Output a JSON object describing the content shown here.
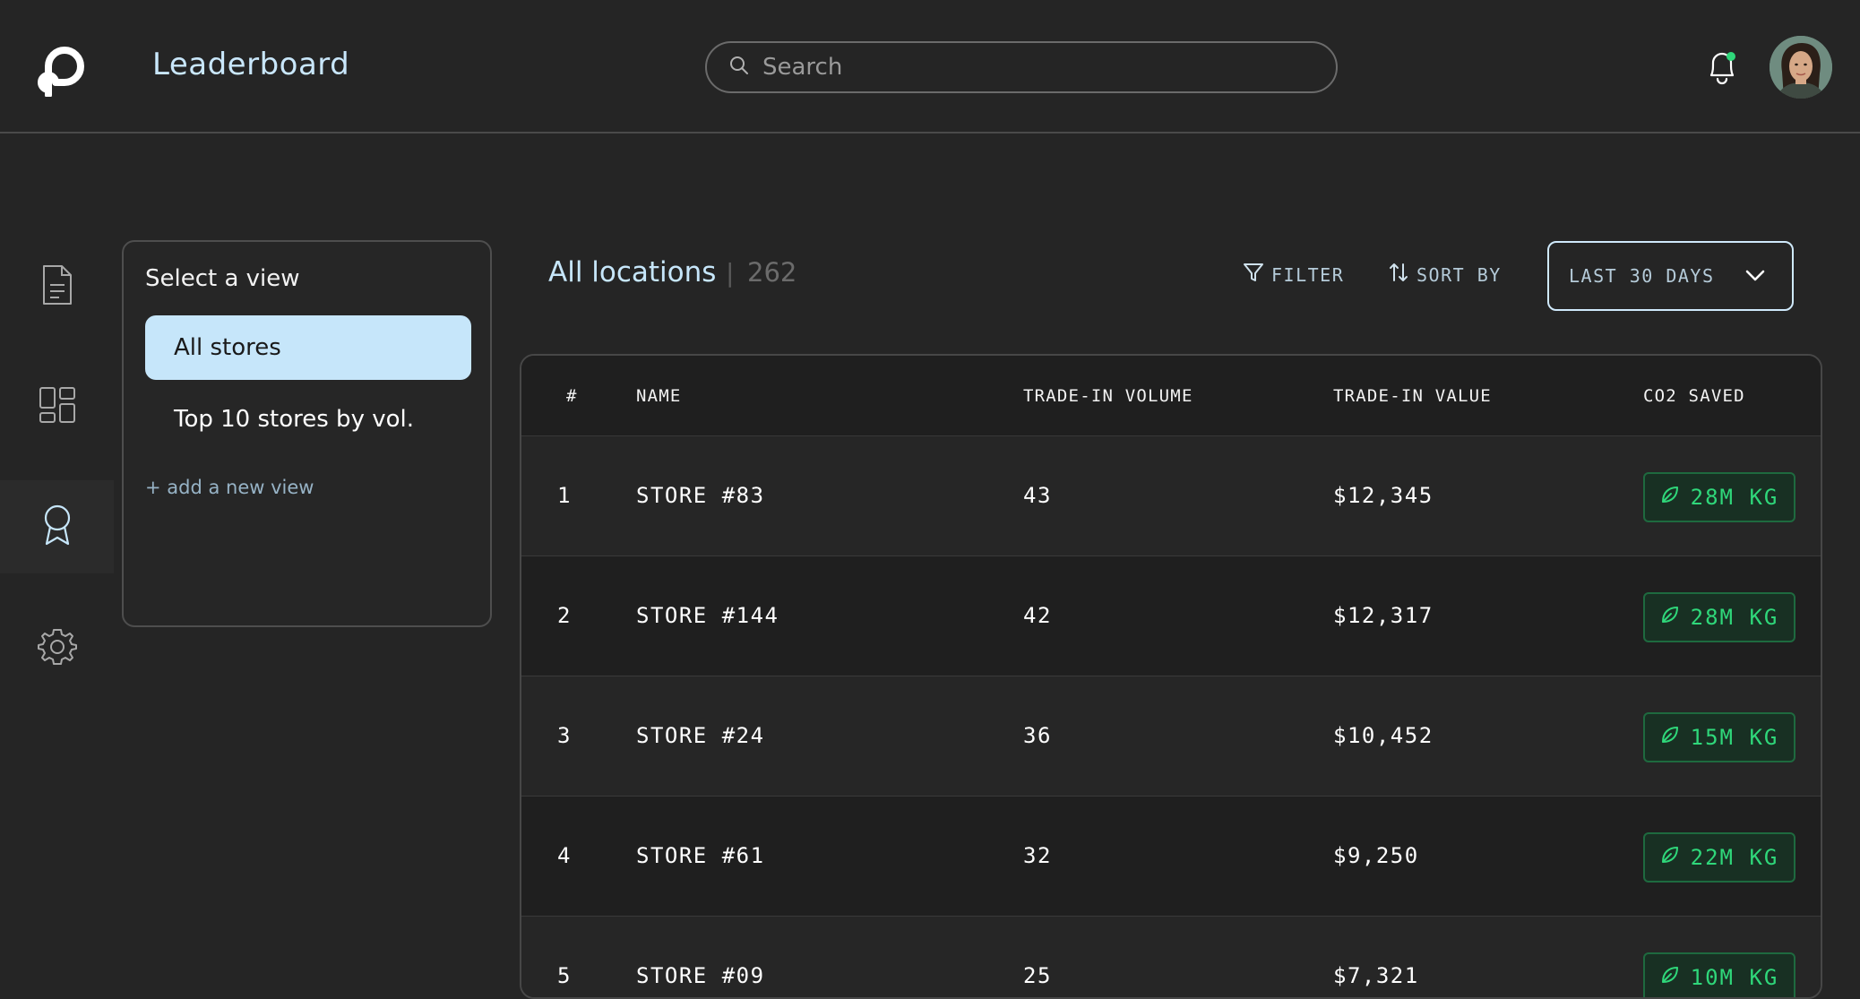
{
  "header": {
    "title": "Leaderboard",
    "search_placeholder": "Search",
    "notification_dot_color": "#2fd77a"
  },
  "sidebar": {
    "items": [
      {
        "icon": "document-icon"
      },
      {
        "icon": "dashboard-icon"
      },
      {
        "icon": "award-icon",
        "active": true
      },
      {
        "icon": "gear-icon"
      }
    ]
  },
  "views": {
    "title": "Select a view",
    "items": [
      {
        "label": "All stores",
        "selected": true
      },
      {
        "label": "Top 10 stores by vol."
      }
    ],
    "add_label": "+ add a new view"
  },
  "locations": {
    "title": "All locations",
    "separator": "|",
    "count": "262",
    "filter_label": "FILTER",
    "sort_label": "SORT BY",
    "date_range": "LAST 30 DAYS"
  },
  "table": {
    "columns": [
      "#",
      "NAME",
      "TRADE-IN VOLUME",
      "TRADE-IN VALUE",
      "CO2 SAVED"
    ],
    "rows": [
      {
        "rank": "1",
        "name": "STORE #83",
        "volume": "43",
        "value": "$12,345",
        "co2": "28M KG"
      },
      {
        "rank": "2",
        "name": "STORE #144",
        "volume": "42",
        "value": "$12,317",
        "co2": "28M KG"
      },
      {
        "rank": "3",
        "name": "STORE #24",
        "volume": "36",
        "value": "$10,452",
        "co2": "15M KG"
      },
      {
        "rank": "4",
        "name": "STORE #61",
        "volume": "32",
        "value": "$9,250",
        "co2": "22M KG"
      },
      {
        "rank": "5",
        "name": "STORE #09",
        "volume": "25",
        "value": "$7,321",
        "co2": "10M KG"
      }
    ]
  },
  "colors": {
    "accent": "#c6e6fa",
    "co2_green": "#2fd77a",
    "background": "#252525"
  }
}
